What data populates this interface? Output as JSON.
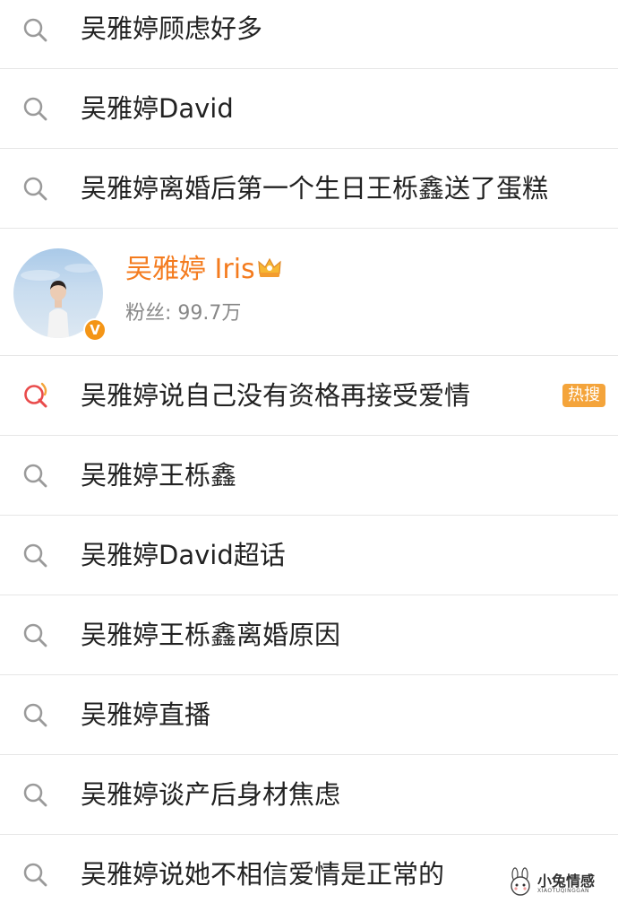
{
  "suggestions_top": [
    {
      "label": "吴雅婷顾虑好多",
      "icon": "search-icon"
    },
    {
      "label": "吴雅婷David",
      "icon": "search-icon"
    },
    {
      "label": "吴雅婷离婚后第一个生日王栎鑫送了蛋糕",
      "icon": "search-icon"
    }
  ],
  "user_card": {
    "name": "吴雅婷 Iris",
    "fans": "粉丝: 99.7万",
    "verified_mark": "V",
    "name_color": "#f47b1e",
    "badge_color": "#f49516"
  },
  "suggestions_bottom": [
    {
      "label": "吴雅婷说自己没有资格再接受爱情",
      "icon": "hot-search-icon",
      "badge": "热搜"
    },
    {
      "label": "吴雅婷王栎鑫",
      "icon": "search-icon"
    },
    {
      "label": "吴雅婷David超话",
      "icon": "search-icon"
    },
    {
      "label": "吴雅婷王栎鑫离婚原因",
      "icon": "search-icon"
    },
    {
      "label": "吴雅婷直播",
      "icon": "search-icon"
    },
    {
      "label": "吴雅婷谈产后身材焦虑",
      "icon": "search-icon"
    },
    {
      "label": "吴雅婷说她不相信爱情是正常的",
      "icon": "search-icon"
    }
  ],
  "watermark": {
    "title": "小兔情感",
    "subtitle": "XIAOTUQINGGAN"
  },
  "colors": {
    "hot_badge": "#f4a43b",
    "divider": "#e6e6e6",
    "text": "#222222"
  }
}
